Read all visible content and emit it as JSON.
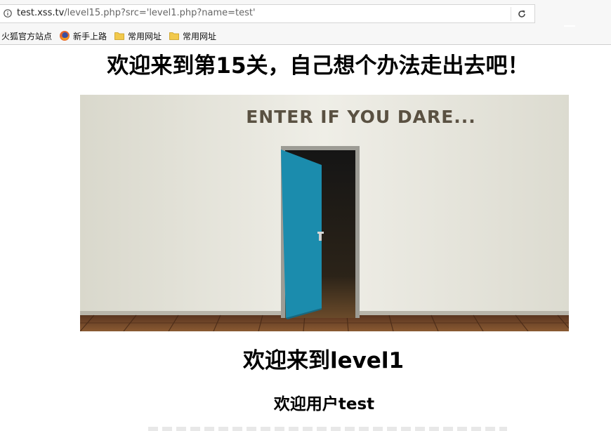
{
  "browser": {
    "url_host": "test.xss.tv",
    "url_path": "/level15.php?src='level1.php?name=test'",
    "bookmarks": [
      {
        "label": "火狐官方站点",
        "icon": "none"
      },
      {
        "label": "新手上路",
        "icon": "firefox-icon"
      },
      {
        "label": "常用网址",
        "icon": "folder-icon"
      },
      {
        "label": "常用网址",
        "icon": "folder-icon"
      }
    ]
  },
  "page": {
    "title": "欢迎来到第15关，自己想个办法走出去吧！",
    "image_caption": "ENTER IF YOU DARE...",
    "included_heading": "欢迎来到level1",
    "welcome_user": "欢迎用户test"
  },
  "colors": {
    "door": "#1b8cad",
    "wall": "#e9e8e0",
    "floor": "#6b3f24"
  }
}
